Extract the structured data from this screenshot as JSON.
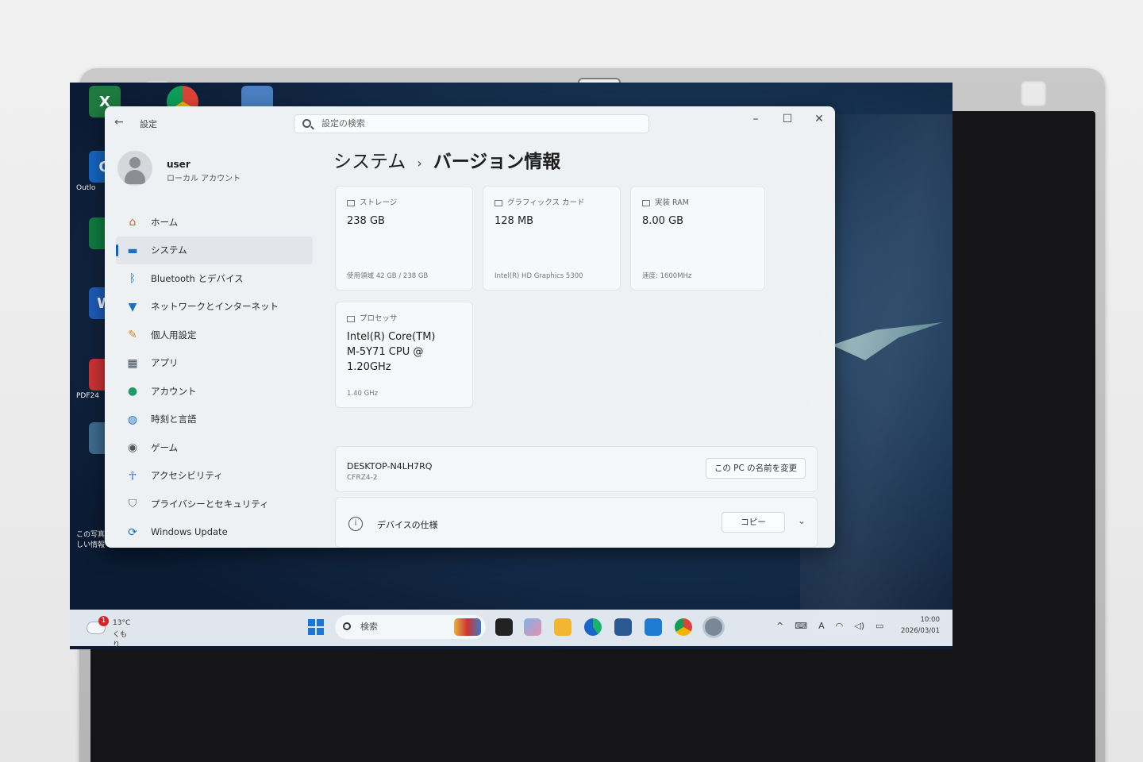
{
  "settings": {
    "app_title": "設定",
    "search_placeholder": "設定の検索",
    "window_controls": {
      "minimize": "–",
      "maximize": "☐",
      "close": "✕"
    },
    "user": {
      "name": "user",
      "account_type": "ローカル アカウント"
    },
    "nav": [
      {
        "label": "ホーム",
        "icon": "home-icon",
        "active": false
      },
      {
        "label": "システム",
        "icon": "system-icon",
        "active": true
      },
      {
        "label": "Bluetooth とデバイス",
        "icon": "bluetooth-icon",
        "active": false
      },
      {
        "label": "ネットワークとインターネット",
        "icon": "wifi-icon",
        "active": false
      },
      {
        "label": "個人用設定",
        "icon": "brush-icon",
        "active": false
      },
      {
        "label": "アプリ",
        "icon": "apps-icon",
        "active": false
      },
      {
        "label": "アカウント",
        "icon": "account-icon",
        "active": false
      },
      {
        "label": "時刻と言語",
        "icon": "globe-icon",
        "active": false
      },
      {
        "label": "ゲーム",
        "icon": "gamepad-icon",
        "active": false
      },
      {
        "label": "アクセシビリティ",
        "icon": "accessibility-icon",
        "active": false
      },
      {
        "label": "プライバシーとセキュリティ",
        "icon": "shield-icon",
        "active": false
      },
      {
        "label": "Windows Update",
        "icon": "update-icon",
        "active": false
      }
    ],
    "breadcrumb": {
      "parent": "システム",
      "separator": "›",
      "current": "バージョン情報"
    },
    "cards": {
      "storage": {
        "label": "ストレージ",
        "value": "238 GB",
        "sub": "使用領域 42 GB / 238 GB"
      },
      "graphics": {
        "label": "グラフィックス カード",
        "value": "128 MB",
        "sub": "Intel(R) HD Graphics 5300"
      },
      "ram": {
        "label": "実装 RAM",
        "value": "8.00 GB",
        "sub": "速度: 1600MHz"
      },
      "processor": {
        "label": "プロセッサ",
        "value_lines": [
          "Intel(R) Core(TM)",
          "M-5Y71 CPU @",
          "1.20GHz"
        ],
        "sub": "1.40 GHz"
      }
    },
    "device": {
      "name": "DESKTOP-N4LH7RQ",
      "model": "CFRZ4-2",
      "rename_button": "この PC の名前を変更"
    },
    "spec": {
      "label": "デバイスの仕様",
      "copy_button": "コピー",
      "info_glyph": "i"
    }
  },
  "taskbar": {
    "weather": {
      "temp": "13°C",
      "condition": "くもり",
      "badge": "1"
    },
    "search_label": "検索",
    "clock": {
      "time": "10:00",
      "date": "2026/03/01"
    },
    "tray_icons": [
      "chevron-up-icon",
      "keyboard-icon",
      "ime-icon",
      "wifi-icon",
      "volume-icon",
      "battery-icon"
    ],
    "tray_glyphs": {
      "chevron": "^",
      "ime": "A"
    }
  },
  "desktop": {
    "icon_labels": [
      "Outlo",
      "PDF24",
      "この写真\nしい情報"
    ]
  },
  "hardware": {
    "win_key": "windows-key",
    "camera": "webcam"
  },
  "colors": {
    "accent": "#0b62c5",
    "window_bg": "#eef1f3",
    "desktop": "#183353"
  }
}
